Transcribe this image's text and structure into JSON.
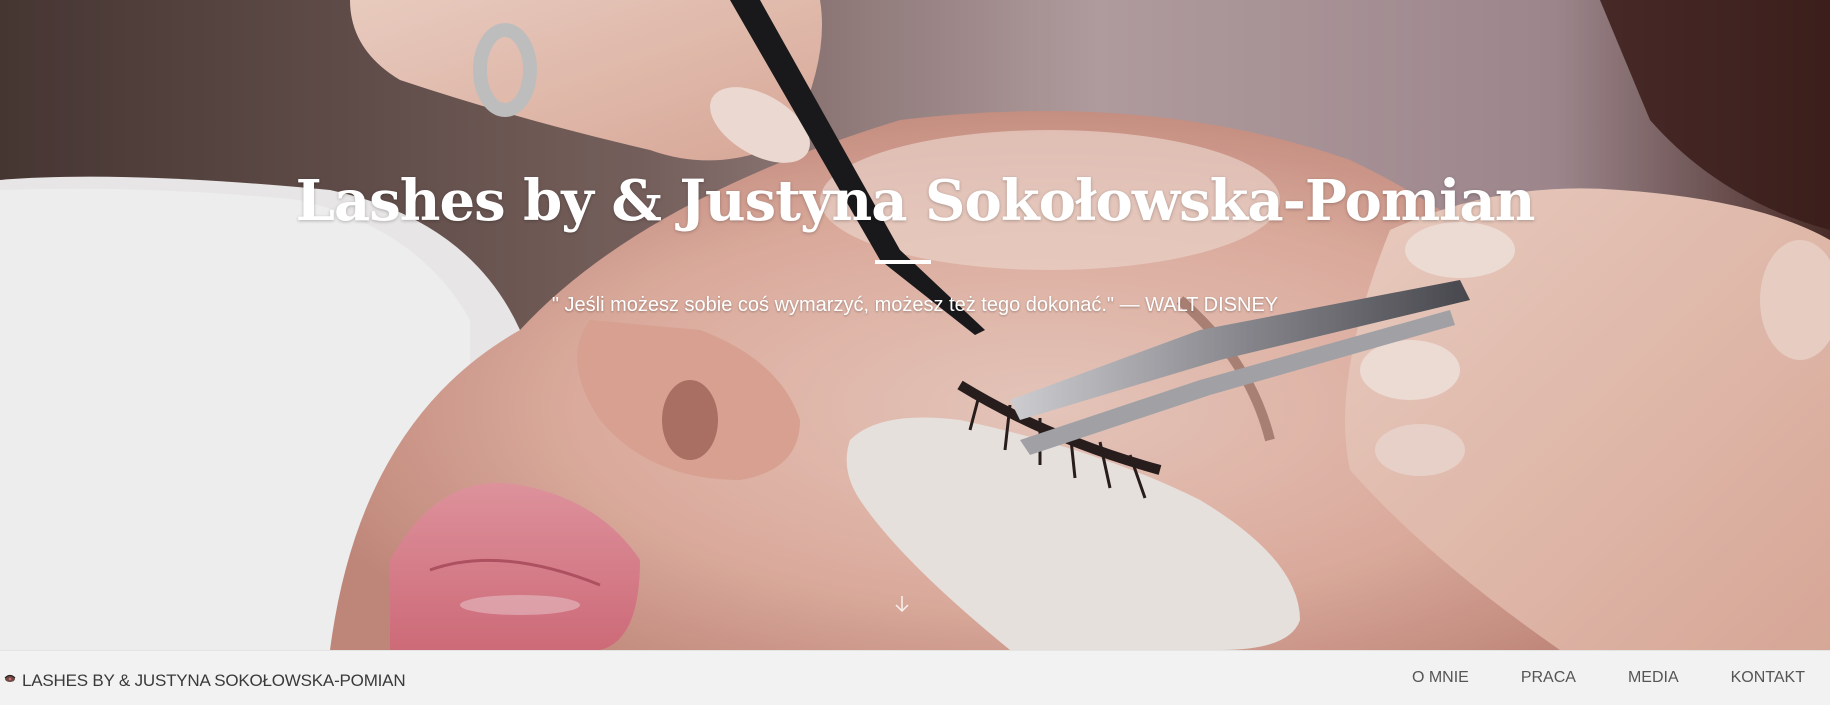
{
  "hero": {
    "title": "Lashes by & Justyna Sokołowska-Pomian",
    "quote": "\" Jeśli możesz sobie coś wymarzyć, możesz też tego dokonać.\" — WALT DISNEY",
    "scroll_icon": "arrow-down-icon"
  },
  "navbar": {
    "brand": "LASHES BY & JUSTYNA SOKOŁOWSKA-POMIAN",
    "brand_icon": "logo-icon",
    "links": [
      "O MNIE",
      "PRACA",
      "MEDIA",
      "KONTAKT"
    ]
  },
  "colors": {
    "nav_background": "#f2f2f2",
    "nav_text": "#555555",
    "hero_text": "#ffffff"
  }
}
